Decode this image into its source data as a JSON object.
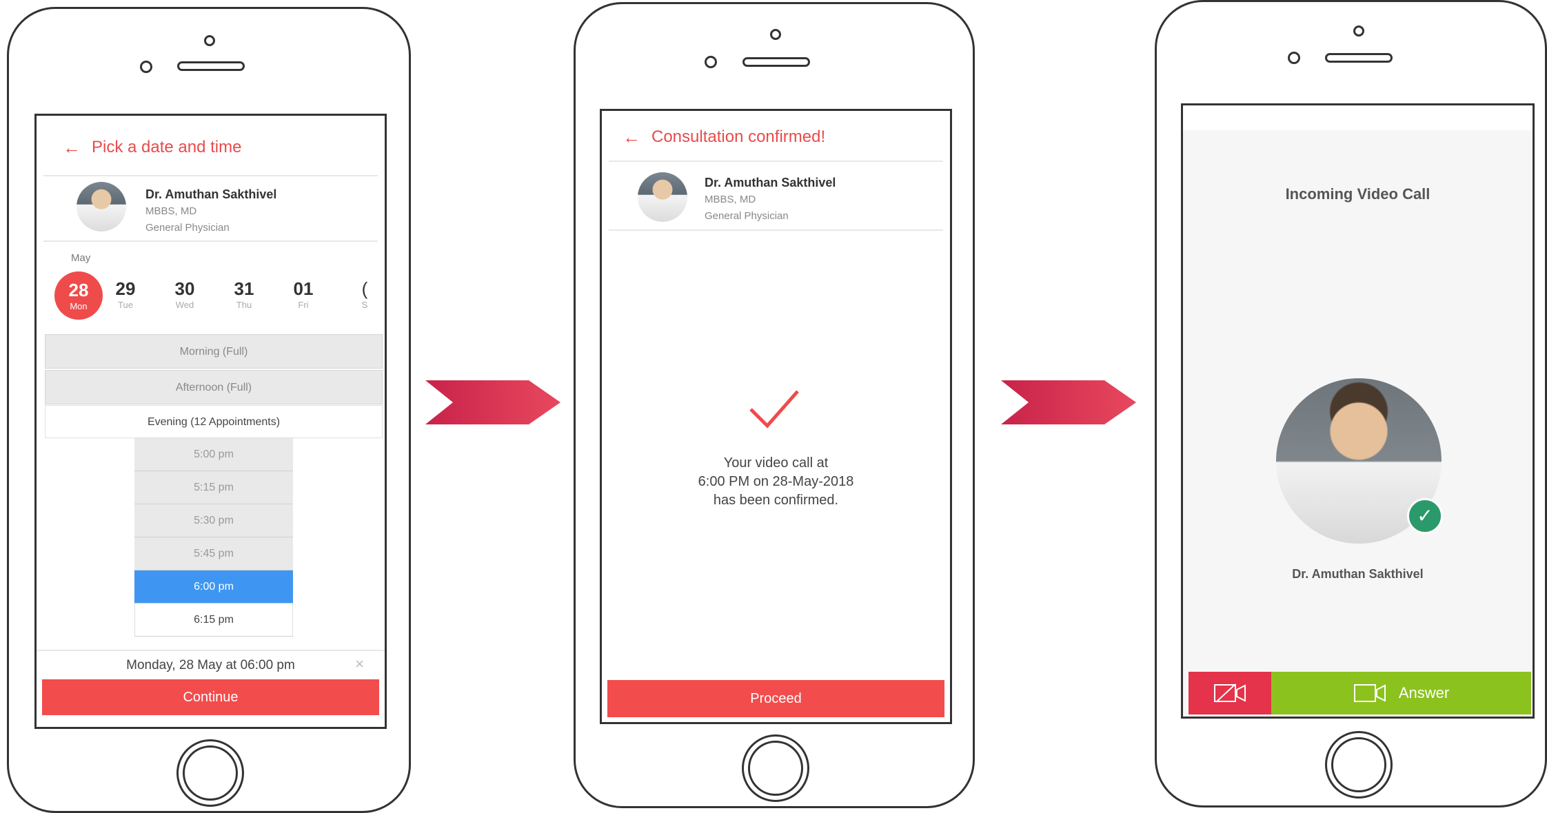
{
  "doctor": {
    "name": "Dr. Amuthan Sakthivel",
    "degree": "MBBS, MD",
    "specialty": "General Physician"
  },
  "screen1": {
    "title": "Pick a date and time",
    "month": "May",
    "dates": [
      {
        "day": "28",
        "weekday": "Mon",
        "selected": true
      },
      {
        "day": "29",
        "weekday": "Tue"
      },
      {
        "day": "30",
        "weekday": "Wed"
      },
      {
        "day": "31",
        "weekday": "Thu"
      },
      {
        "day": "01",
        "weekday": "Fri"
      },
      {
        "day": "(",
        "weekday": "S"
      }
    ],
    "sessions": [
      "Morning (Full)",
      "Afternoon (Full)",
      "Evening (12 Appointments)"
    ],
    "times": [
      "5:00 pm",
      "5:15 pm",
      "5:30 pm",
      "5:45 pm",
      "6:00 pm",
      "6:15 pm"
    ],
    "selected_time": "6:00 pm",
    "summary": "Monday, 28 May at 06:00 pm",
    "clear_glyph": "×",
    "continue_label": "Continue"
  },
  "screen2": {
    "title": "Consultation confirmed!",
    "message_line1": "Your video call at",
    "message_line2": "6:00 PM on 28-May-2018",
    "message_line3": "has been confirmed.",
    "proceed_label": "Proceed"
  },
  "screen3": {
    "title": "Incoming Video Call",
    "caller": "Dr. Amuthan Sakthivel",
    "answer_label": "Answer"
  },
  "colors": {
    "accent_red": "#ef4b4b",
    "selected_blue": "#3e96f2",
    "answer_green": "#8cc21e",
    "decline_red": "#e4334a",
    "chevron": "#d12a4d"
  }
}
